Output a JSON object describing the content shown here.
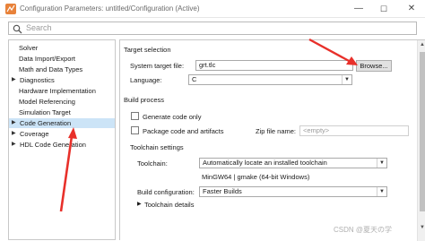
{
  "window": {
    "title": "Configuration Parameters: untitled/Configuration (Active)",
    "minimize_glyph": "—",
    "maximize_glyph": "☐",
    "close_glyph": "✕"
  },
  "search": {
    "placeholder": "Search"
  },
  "tree": {
    "items": [
      {
        "label": "Solver",
        "expandable": false,
        "selected": false
      },
      {
        "label": "Data Import/Export",
        "expandable": false,
        "selected": false
      },
      {
        "label": "Math and Data Types",
        "expandable": false,
        "selected": false
      },
      {
        "label": "Diagnostics",
        "expandable": true,
        "selected": false
      },
      {
        "label": "Hardware Implementation",
        "expandable": false,
        "selected": false
      },
      {
        "label": "Model Referencing",
        "expandable": false,
        "selected": false
      },
      {
        "label": "Simulation Target",
        "expandable": false,
        "selected": false
      },
      {
        "label": "Code Generation",
        "expandable": true,
        "selected": true
      },
      {
        "label": "Coverage",
        "expandable": true,
        "selected": false
      },
      {
        "label": "HDL Code Generation",
        "expandable": true,
        "selected": false
      }
    ]
  },
  "target_selection": {
    "title": "Target selection",
    "system_target_file_label": "System target file:",
    "system_target_file_value": "grt.tlc",
    "browse_label": "Browse...",
    "language_label": "Language:",
    "language_value": "C"
  },
  "build_process": {
    "title": "Build process",
    "generate_code_only_label": "Generate code only",
    "package_label": "Package code and artifacts",
    "zip_label": "Zip file name:",
    "zip_placeholder": "<empty>"
  },
  "toolchain_settings": {
    "title": "Toolchain settings",
    "toolchain_label": "Toolchain:",
    "toolchain_value": "Automatically locate an installed toolchain",
    "toolchain_note": "MinGW64 | gmake (64-bit Windows)",
    "build_config_label": "Build configuration:",
    "build_config_value": "Faster Builds",
    "details_label": "Toolchain details"
  },
  "watermark": "CSDN @夏天の学",
  "colors": {
    "selected_row": "#cce4f7",
    "annotation_arrow": "#e8302a"
  },
  "icons": {
    "dropdown": "▼",
    "expand_arrow": "▶",
    "scroll_up": "▲",
    "scroll_down": "▼"
  }
}
